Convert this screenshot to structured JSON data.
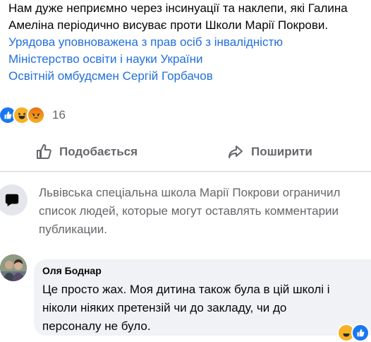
{
  "post": {
    "line1": "Нам дуже неприємно через інсинуації та наклепи, які Галина",
    "line2": "Амеліна періодично висуває проти Школи Марії Покрови.",
    "link1": "Урядова уповноважена з прав осіб з інвалідністю",
    "link2": "Міністерство освіти і науки України",
    "link3": "Освітній омбудсмен Сергій Горбачов"
  },
  "reactions": {
    "count": "16"
  },
  "actions": {
    "like": "Подобається",
    "share": "Поширити"
  },
  "restricted": {
    "line1": "Львівська спеціальна школа Марії Покрови ограничил",
    "line2": "список людей, которые могут оставлять комментарии",
    "line3": "публикации."
  },
  "comment": {
    "author": "Оля Боднар",
    "line1": "Це просто жах. Моя дитина також була в цій школі і",
    "line2": "ніколи ніяких претензій чи до закладу, чи до",
    "line3": "персоналу не було."
  }
}
